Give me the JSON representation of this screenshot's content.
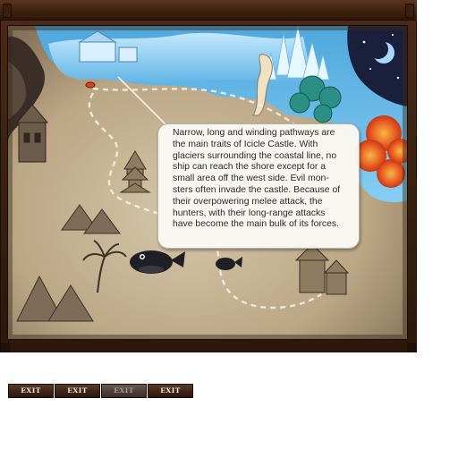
{
  "map": {
    "region_name": "Icicle Castle",
    "description_lines": [
      "Narrow, long and winding pathways are",
      "the main traits of Icicle Castle. With",
      "glaciers surrounding the coastal line, no",
      "ship can reach the shore except for a",
      "small area off the west side. Evil mon-",
      "sters often invade the castle. Because of",
      "their overpowering melee attack, the",
      "hunters, with their long-range attacks",
      "have become the main bulk of its forces."
    ]
  },
  "buttons": [
    {
      "label": "EXIT",
      "state": "normal"
    },
    {
      "label": "EXIT",
      "state": "normal"
    },
    {
      "label": "EXIT",
      "state": "disabled"
    },
    {
      "label": "EXIT",
      "state": "normal"
    }
  ],
  "colors": {
    "frame": "#3a200f",
    "parchment": "#c9b79a",
    "ice": "#7ec8ee",
    "night_sky": "#1a1f3c",
    "autumn_trees": "#e0451a",
    "button_bg": "#3d2418",
    "button_text": "#f4e9dc"
  },
  "icons": {
    "moon": "crescent-moon-icon",
    "whale": "whale-icon",
    "castle": "castle-icon",
    "pagoda": "pagoda-icon",
    "location_marker": "map-marker-icon"
  }
}
